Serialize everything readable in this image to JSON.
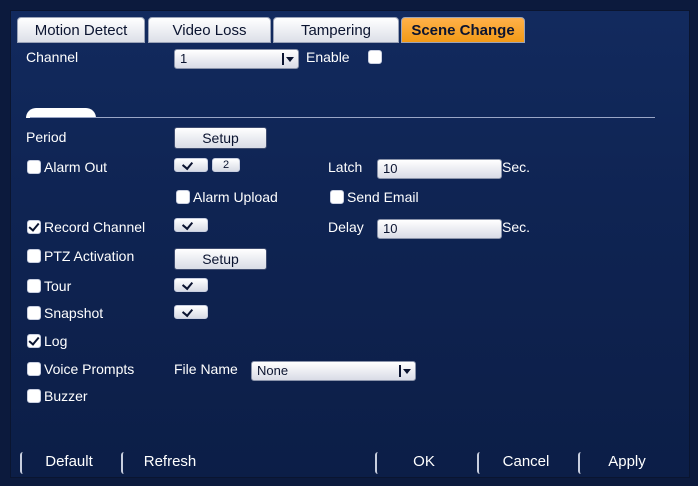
{
  "tabs": [
    "Motion Detect",
    "Video Loss",
    "Tampering",
    "Scene Change"
  ],
  "active_tab": "Scene Change",
  "channel": {
    "label": "Channel",
    "value": "1"
  },
  "enable": {
    "label": "Enable",
    "checked": false
  },
  "period": {
    "label": "Period",
    "button": "Setup"
  },
  "alarm_out": {
    "label": "Alarm Out",
    "checked": false,
    "number": "2"
  },
  "latch": {
    "label": "Latch",
    "value": "10",
    "unit": "Sec."
  },
  "alarm_upload": {
    "label": "Alarm Upload",
    "checked": false
  },
  "send_email": {
    "label": "Send Email",
    "checked": false
  },
  "record_channel": {
    "label": "Record Channel",
    "checked": true
  },
  "delay": {
    "label": "Delay",
    "value": "10",
    "unit": "Sec."
  },
  "ptz": {
    "label": "PTZ Activation",
    "checked": false,
    "button": "Setup"
  },
  "tour": {
    "label": "Tour",
    "checked": false
  },
  "snapshot": {
    "label": "Snapshot",
    "checked": false
  },
  "log": {
    "label": "Log",
    "checked": true
  },
  "voice_prompts": {
    "label": "Voice Prompts",
    "checked": false,
    "file_name_label": "File Name",
    "file_name_value": "None"
  },
  "buzzer": {
    "label": "Buzzer",
    "checked": false
  },
  "bottom": {
    "default": "Default",
    "refresh": "Refresh",
    "ok": "OK",
    "cancel": "Cancel",
    "apply": "Apply"
  },
  "colors": {
    "active_tab": "#f29a16",
    "background": "#0f2453"
  }
}
